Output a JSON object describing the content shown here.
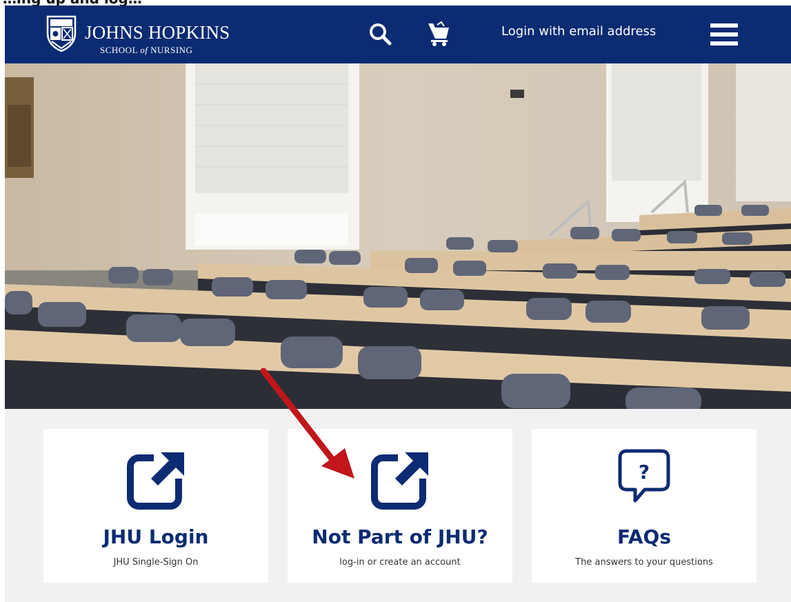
{
  "top_strip_text": "…ing up and log…",
  "header": {
    "logo_title": "JOHNS HOPKINS",
    "logo_subtitle_1": "SCHOOL",
    "logo_subtitle_of": "of",
    "logo_subtitle_2": "NURSING",
    "login_link": "Login with email address",
    "icons": [
      "search-icon",
      "cart-icon",
      "menu-icon"
    ]
  },
  "cards": [
    {
      "title": "JHU Login",
      "subtitle": "JHU Single-Sign On",
      "icon": "external-link-icon"
    },
    {
      "title": "Not Part of JHU?",
      "subtitle": "log-in or create an account",
      "icon": "external-link-icon"
    },
    {
      "title": "FAQs",
      "subtitle": "The answers to your questions",
      "icon": "question-bubble-icon"
    }
  ],
  "colors": {
    "brand_navy": "#0b2b72",
    "annotation_arrow": "#c0161c",
    "cards_background": "#f1f1f1"
  }
}
